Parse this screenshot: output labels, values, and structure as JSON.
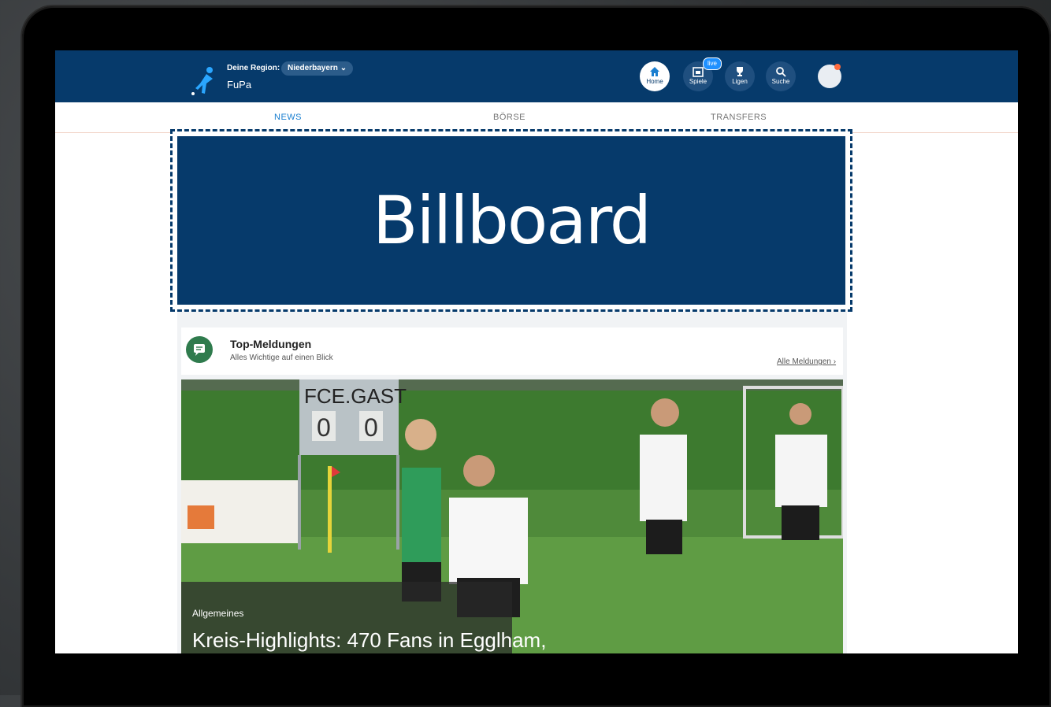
{
  "header": {
    "region_label": "Deine Region:",
    "region_value": "Niederbayern",
    "brand": "FuPa",
    "nav": [
      {
        "label": "Home",
        "icon": "home-icon",
        "active": true
      },
      {
        "label": "Spiele",
        "icon": "calendar-icon",
        "badge": "live"
      },
      {
        "label": "Ligen",
        "icon": "trophy-icon"
      },
      {
        "label": "Suche",
        "icon": "search-icon"
      }
    ]
  },
  "subnav": {
    "tabs": [
      {
        "label": "NEWS",
        "active": true
      },
      {
        "label": "BÖRSE"
      },
      {
        "label": "TRANSFERS"
      }
    ]
  },
  "billboard": {
    "text": "Billboard"
  },
  "top_meldungen": {
    "title": "Top-Meldungen",
    "subtitle": "Alles Wichtige auf einen Blick",
    "link": "Alle Meldungen ›"
  },
  "featured": {
    "scoreboard": {
      "home": "FCE.",
      "away": "GAST",
      "home_score": "0",
      "away_score": "0"
    },
    "category": "Allgemeines",
    "title": "Kreis-Highlights: 470 Fans in Egglham,"
  },
  "colors": {
    "brand_blue": "#063a6b",
    "accent_green": "#2f7b4d",
    "live_blue": "#1e90ff"
  }
}
